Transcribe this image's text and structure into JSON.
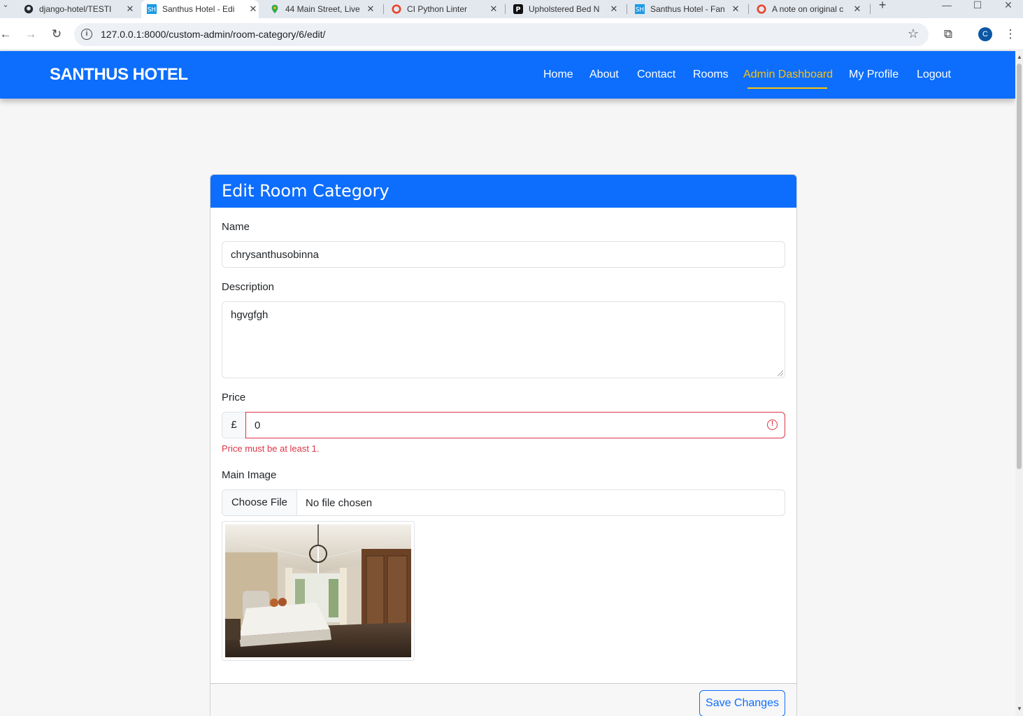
{
  "browser": {
    "tabs": [
      {
        "title": "django-hotel/TESTI",
        "icon": "github-icon"
      },
      {
        "title": "Santhus Hotel - Edi",
        "icon": "sh-icon"
      },
      {
        "title": "44 Main Street, Live",
        "icon": "maps-icon"
      },
      {
        "title": "CI Python Linter",
        "icon": "ci-icon"
      },
      {
        "title": "Upholstered Bed N",
        "icon": "p-icon"
      },
      {
        "title": "Santhus Hotel - Fan",
        "icon": "sh-icon"
      },
      {
        "title": "A note on original c",
        "icon": "ci-icon"
      }
    ],
    "url": "127.0.0.1:8000/custom-admin/room-category/6/edit/",
    "profile_initial": "C"
  },
  "site": {
    "brand": "SANTHUS HOTEL",
    "nav": [
      "Home",
      "About",
      "Contact",
      "Rooms",
      "Admin Dashboard",
      "My Profile",
      "Logout"
    ],
    "active_nav": "Admin Dashboard",
    "accent_color": "#0d6efd",
    "active_color": "#ffc107"
  },
  "form": {
    "title": "Edit Room Category",
    "name_label": "Name",
    "name_value": "chrysanthusobinna",
    "description_label": "Description",
    "description_value": "hgvgfgh",
    "price_label": "Price",
    "currency": "£",
    "price_value": "0",
    "price_error": "Price must be at least 1.",
    "image_label": "Main Image",
    "choose_file": "Choose File",
    "file_status": "No file chosen",
    "save_label": "Save Changes"
  }
}
